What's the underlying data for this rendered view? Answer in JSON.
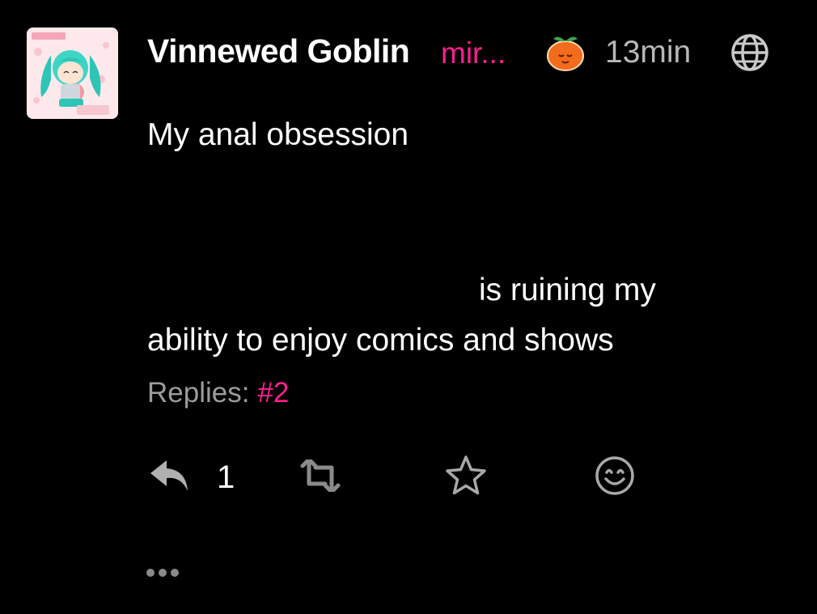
{
  "post": {
    "author": {
      "display_name": "Vinnewed Goblin",
      "handle": "mir...",
      "avatar_icon": "chibi-character-avatar"
    },
    "instance_icon": "tangerine-icon",
    "timestamp": "13min",
    "visibility_icon": "globe-icon",
    "content": {
      "line_1": "My anal obsession",
      "line_2a": "is ruining my",
      "line_2b": "ability to enjoy comics and shows"
    },
    "replies": {
      "label": "Replies:",
      "link": "#2"
    },
    "actions": {
      "reply_icon": "reply-icon",
      "reply_count": "1",
      "boost_icon": "boost-icon",
      "favourite_icon": "star-icon",
      "reaction_icon": "smiley-icon",
      "more_icon": "more-options-icon"
    }
  },
  "colors": {
    "background": "#000000",
    "text": "#ffffff",
    "muted": "#b8b8b8",
    "accent": "#ff1f8f",
    "icon": "#9a9a9a"
  }
}
